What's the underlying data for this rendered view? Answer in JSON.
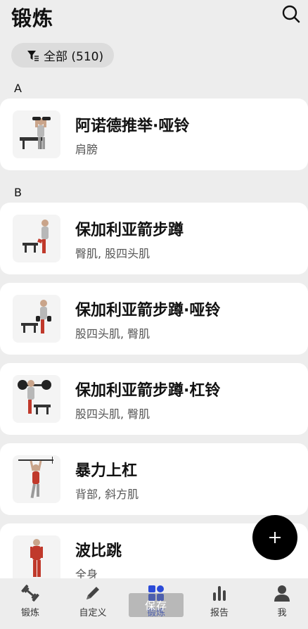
{
  "header": {
    "title": "锻炼"
  },
  "filter": {
    "label": "全部 (510)"
  },
  "sections": [
    {
      "letter": "A"
    },
    {
      "letter": "B"
    }
  ],
  "exercises": [
    {
      "name": "阿诺德推举·哑铃",
      "muscles": "肩膀",
      "thumb": "dumbbell-press-icon"
    },
    {
      "name": "保加利亚箭步蹲",
      "muscles": "臀肌, 股四头肌",
      "thumb": "split-squat-icon"
    },
    {
      "name": "保加利亚箭步蹲·哑铃",
      "muscles": "股四头肌, 臀肌",
      "thumb": "dumbbell-split-squat-icon"
    },
    {
      "name": "保加利亚箭步蹲·杠铃",
      "muscles": "股四头肌, 臀肌",
      "thumb": "barbell-split-squat-icon"
    },
    {
      "name": "暴力上杠",
      "muscles": "背部, 斜方肌",
      "thumb": "muscle-up-icon"
    },
    {
      "name": "波比跳",
      "muscles": "全身",
      "thumb": "burpee-icon"
    }
  ],
  "tabs": [
    {
      "label": "锻炼",
      "icon": "dumbbell-icon"
    },
    {
      "label": "自定义",
      "icon": "pencil-icon"
    },
    {
      "label": "锻炼",
      "icon": "grid-icon",
      "active": true
    },
    {
      "label": "报告",
      "icon": "bar-chart-icon"
    },
    {
      "label": "我",
      "icon": "user-icon"
    }
  ],
  "save_overlay": {
    "label": "保存"
  },
  "colors": {
    "accent": "#2b4bd8",
    "background": "#ededed",
    "card": "#ffffff",
    "fab": "#000000"
  }
}
